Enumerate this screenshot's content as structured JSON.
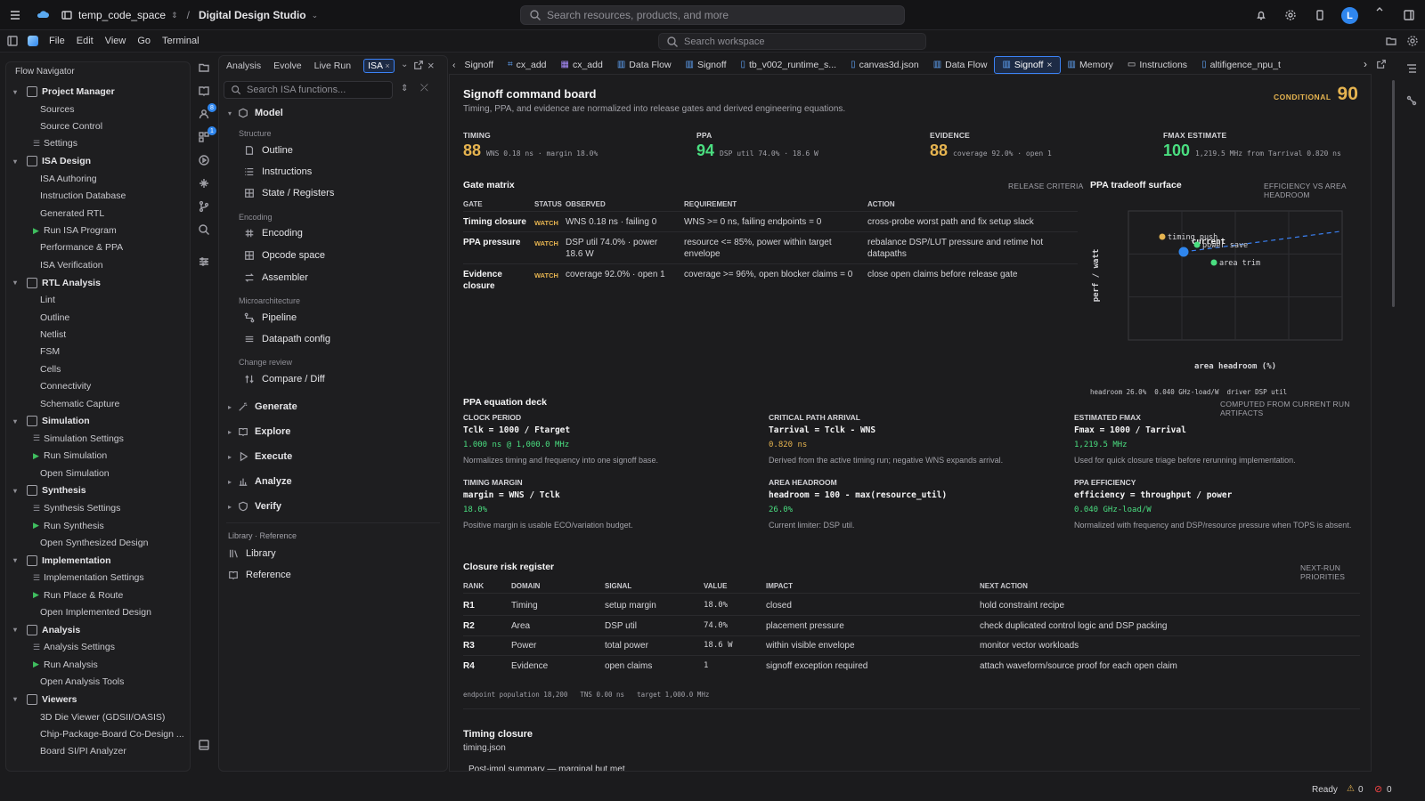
{
  "topbar": {
    "workspace": "temp_code_space",
    "project": "Digital Design Studio",
    "search_placeholder": "Search resources, products, and more",
    "avatar": "L"
  },
  "menubar": {
    "items": [
      "File",
      "Edit",
      "View",
      "Go",
      "Terminal"
    ],
    "search_placeholder": "Search workspace"
  },
  "nav": {
    "title": "Flow Navigator",
    "groups": [
      {
        "label": "Project Manager",
        "items": [
          "Sources",
          "Source Control",
          "Settings"
        ]
      },
      {
        "label": "ISA Design",
        "items": [
          "ISA Authoring",
          "Instruction Database",
          "Generated RTL",
          "Run ISA Program",
          "Performance & PPA",
          "ISA Verification"
        ]
      },
      {
        "label": "RTL Analysis",
        "items": [
          "Lint",
          "Outline",
          "Netlist",
          "FSM",
          "Cells",
          "Connectivity",
          "Schematic Capture"
        ]
      },
      {
        "label": "Simulation",
        "items": [
          "Simulation Settings",
          "Run Simulation",
          "Open Simulation"
        ]
      },
      {
        "label": "Synthesis",
        "items": [
          "Synthesis Settings",
          "Run Synthesis",
          "Open Synthesized Design"
        ]
      },
      {
        "label": "Implementation",
        "items": [
          "Implementation Settings",
          "Run Place & Route",
          "Open Implemented Design"
        ]
      },
      {
        "label": "Analysis",
        "items": [
          "Analysis Settings",
          "Run Analysis",
          "Open Analysis Tools"
        ]
      },
      {
        "label": "Viewers",
        "items": [
          "3D Die Viewer (GDSII/OASIS)",
          "Chip-Package-Board Co-Design ...",
          "Board SI/PI Analyzer"
        ]
      }
    ]
  },
  "rail": {
    "badge1": "8",
    "badge2": "1"
  },
  "isa": {
    "tabs": [
      "Analysis",
      "Evolve",
      "Live Run",
      "ISA"
    ],
    "search_placeholder": "Search ISA functions...",
    "model": "Model",
    "sec_structure": "Structure",
    "outline": "Outline",
    "instructions": "Instructions",
    "state": "State / Registers",
    "sec_encoding": "Encoding",
    "encoding": "Encoding",
    "opcode": "Opcode space",
    "assembler": "Assembler",
    "sec_micro": "Microarchitecture",
    "pipeline": "Pipeline",
    "datapath": "Datapath config",
    "sec_change": "Change review",
    "compare": "Compare / Diff",
    "generate": "Generate",
    "explore": "Explore",
    "execute": "Execute",
    "analyze": "Analyze",
    "verify": "Verify",
    "sec_lib": "Library · Reference",
    "library": "Library",
    "reference": "Reference"
  },
  "editor_tabs": [
    "Signoff",
    "cx_add",
    "cx_add",
    "Data Flow",
    "Signoff",
    "tb_v002_runtime_s...",
    "canvas3d.json",
    "Data Flow",
    "Signoff",
    "Memory",
    "Instructions",
    "altifigence_npu_t"
  ],
  "board": {
    "title": "Signoff command board",
    "subtitle": "Timing, PPA, and evidence are normalized into release gates and derived engineering equations.",
    "status": "CONDITIONAL",
    "score": "90",
    "kpis": [
      {
        "label": "TIMING",
        "value": "88",
        "detail": "WNS 0.18 ns · margin 18.0%",
        "color": "#e6b450"
      },
      {
        "label": "PPA",
        "value": "94",
        "detail": "DSP util 74.0% · 18.6 W",
        "color": "#4ade80"
      },
      {
        "label": "EVIDENCE",
        "value": "88",
        "detail": "coverage 92.0% · open 1",
        "color": "#e6b450"
      },
      {
        "label": "FMAX ESTIMATE",
        "value": "100",
        "detail": "1,219.5 MHz from Tarrival 0.820 ns",
        "color": "#4ade80"
      }
    ]
  },
  "gate": {
    "title": "Gate matrix",
    "right_label": "RELEASE CRITERIA",
    "headers": [
      "GATE",
      "STATUS",
      "OBSERVED",
      "REQUIREMENT",
      "ACTION"
    ],
    "rows": [
      {
        "gate": "Timing closure",
        "status": "WATCH",
        "observed": "WNS 0.18 ns · failing 0",
        "requirement": "WNS >= 0 ns, failing endpoints = 0",
        "action": "cross-probe worst path and fix setup slack"
      },
      {
        "gate": "PPA pressure",
        "status": "WATCH",
        "observed": "DSP util 74.0% · power 18.6 W",
        "requirement": "resource <= 85%, power within target envelope",
        "action": "rebalance DSP/LUT pressure and retime hot datapaths"
      },
      {
        "gate": "Evidence closure",
        "status": "WATCH",
        "observed": "coverage 92.0% · open 1",
        "requirement": "coverage >= 96%, open blocker claims = 0",
        "action": "close open claims before release gate"
      }
    ]
  },
  "tradeoff": {
    "title": "PPA tradeoff surface",
    "right_label": "EFFICIENCY VS AREA HEADROOM",
    "ylabel": "perf / watt",
    "xlabel": "area headroom (%)",
    "points": [
      {
        "name": "timing push",
        "color": "#e6b450"
      },
      {
        "name": "current",
        "color": "#2f86ee"
      },
      {
        "name": "power save",
        "color": "#4ade80"
      },
      {
        "name": "area trim",
        "color": "#4ade80"
      }
    ],
    "footer": [
      "headroom 26.0%",
      "0.040 GHz-load/W",
      "driver DSP util"
    ]
  },
  "equations": {
    "title": "PPA equation deck",
    "right_label": "COMPUTED FROM CURRENT RUN ARTIFACTS",
    "cards": [
      {
        "title": "CLOCK PERIOD",
        "formula": "Tclk = 1000 / Ftarget",
        "value": "1.000 ns @ 1,000.0 MHz",
        "note": "Normalizes timing and frequency into one signoff base.",
        "color": "#4ade80"
      },
      {
        "title": "CRITICAL PATH ARRIVAL",
        "formula": "Tarrival = Tclk - WNS",
        "value": "0.820 ns",
        "note": "Derived from the active timing run; negative WNS expands arrival.",
        "color": "#e6b450"
      },
      {
        "title": "ESTIMATED FMAX",
        "formula": "Fmax = 1000 / Tarrival",
        "value": "1,219.5 MHz",
        "note": "Used for quick closure triage before rerunning implementation.",
        "color": "#4ade80"
      },
      {
        "title": "TIMING MARGIN",
        "formula": "margin = WNS / Tclk",
        "value": "18.0%",
        "note": "Positive margin is usable ECO/variation budget.",
        "color": "#4ade80"
      },
      {
        "title": "AREA HEADROOM",
        "formula": "headroom = 100 - max(resource_util)",
        "value": "26.0%",
        "note": "Current limiter: DSP util.",
        "color": "#4ade80"
      },
      {
        "title": "PPA EFFICIENCY",
        "formula": "efficiency = throughput / power",
        "value": "0.040 GHz-load/W",
        "note": "Normalized with frequency and DSP/resource pressure when TOPS is absent.",
        "color": "#4ade80"
      }
    ]
  },
  "risk": {
    "title": "Closure risk register",
    "right_label": "NEXT-RUN PRIORITIES",
    "headers": [
      "RANK",
      "DOMAIN",
      "SIGNAL",
      "VALUE",
      "IMPACT",
      "NEXT ACTION"
    ],
    "rows": [
      {
        "rank": "R1",
        "domain": "Timing",
        "signal": "setup margin",
        "value": "18.0%",
        "impact": "closed",
        "action": "hold constraint recipe"
      },
      {
        "rank": "R2",
        "domain": "Area",
        "signal": "DSP util",
        "value": "74.0%",
        "impact": "placement pressure",
        "action": "check duplicated control logic and DSP packing"
      },
      {
        "rank": "R3",
        "domain": "Power",
        "signal": "total power",
        "value": "18.6 W",
        "impact": "within visible envelope",
        "action": "monitor vector workloads"
      },
      {
        "rank": "R4",
        "domain": "Evidence",
        "signal": "open claims",
        "value": "1",
        "impact": "signoff exception required",
        "action": "attach waveform/source proof for each open claim"
      }
    ],
    "footer": [
      "endpoint population 18,200",
      "TNS 0.00 ns",
      "target 1,000.0 MHz"
    ]
  },
  "timing": {
    "title": "Timing closure",
    "file": "timing.json",
    "summary": "Post-impl summary — marginal but met"
  },
  "status": {
    "ready": "Ready",
    "warnings": "0",
    "errors": "0"
  }
}
